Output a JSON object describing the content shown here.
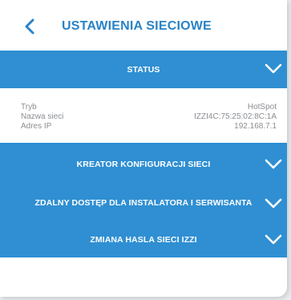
{
  "header": {
    "back_icon": "chevron-left-icon",
    "title": "USTAWIENIA SIECIOWE"
  },
  "status_section": {
    "label": "STATUS",
    "icon": "chevron-down-icon",
    "rows": [
      {
        "key": "Tryb",
        "value": "HotSpot"
      },
      {
        "key": "Nazwa sieci",
        "value": "IZZI4C:75:25:02:8C:1A"
      },
      {
        "key": "Adres IP",
        "value": "192.168.7.1"
      }
    ]
  },
  "sections": [
    {
      "label": "KREATOR KONFIGURACJI SIECI",
      "icon": "chevron-down-icon"
    },
    {
      "label": "ZDALNY DOSTĘP DLA INSTALATORA I SERWISANTA",
      "icon": "chevron-down-icon"
    },
    {
      "label": "ZMIANA HASLA SIECI IZZI",
      "icon": "chevron-down-icon"
    }
  ],
  "colors": {
    "accent": "#2f8fd2",
    "title": "#2a83c6",
    "text_muted": "#8a8d91",
    "background": "#ffffff"
  }
}
